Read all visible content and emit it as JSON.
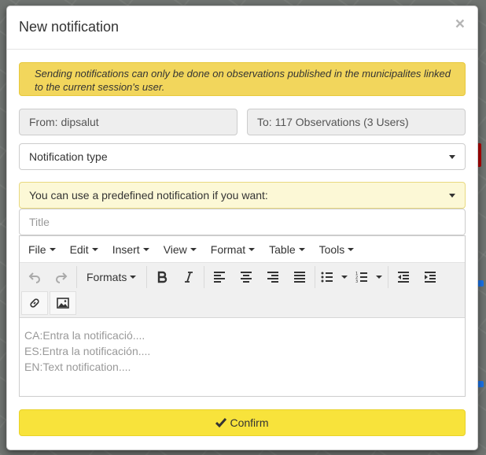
{
  "modal": {
    "title": "New notification",
    "close_label": "×"
  },
  "alert": {
    "text": "Sending notifications can only be done on observations published in the municipalites linked to the current session's user."
  },
  "from_field": {
    "value": "From: dipsalut"
  },
  "to_field": {
    "value": "To: 117 Observations (3 Users)"
  },
  "notification_type": {
    "selected": "Notification type"
  },
  "predefined": {
    "selected": "You can use a predefined notification if you want:"
  },
  "title_input": {
    "placeholder": "Title"
  },
  "editor": {
    "menubar": [
      "File",
      "Edit",
      "Insert",
      "View",
      "Format",
      "Table",
      "Tools"
    ],
    "formats_label": "Formats",
    "toolbar_icons": [
      "undo-icon",
      "redo-icon",
      "bold-icon",
      "italic-icon",
      "align-left-icon",
      "align-center-icon",
      "align-right-icon",
      "align-justify-icon",
      "bullet-list-icon",
      "numbered-list-icon",
      "outdent-icon",
      "indent-icon",
      "link-icon",
      "image-icon"
    ],
    "placeholder_lines": [
      "CA:Entra la notificació....",
      "ES:Entra la notificación....",
      "EN:Text notification...."
    ]
  },
  "confirm": {
    "label": "Confirm"
  },
  "colors": {
    "alert_bg": "#f2d65c",
    "confirm_bg": "#f8e33b",
    "predefined_bg": "#fcf8d6"
  }
}
